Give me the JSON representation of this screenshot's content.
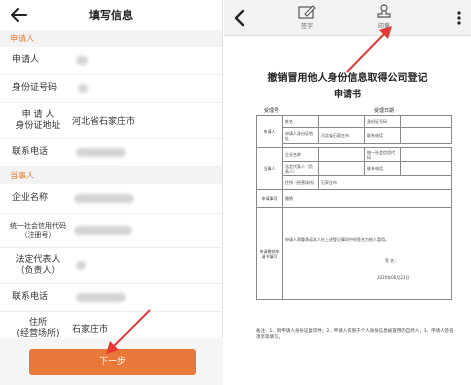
{
  "left": {
    "title": "填写信息",
    "section_applicant": "申请人",
    "section_party": "当事人",
    "fields": {
      "applicant": "申请人",
      "id_number": "身份证号码",
      "id_address": "申 请 人\n身份证地址",
      "id_address_value": "河北省石家庄市",
      "phone": "联系电话",
      "company": "企业名称",
      "credit_code": "统一社会信用代码\n（注册号）",
      "legal_rep": "法定代表人\n（负责人）",
      "phone2": "联系电话",
      "residence": "住所\n(经营场所)",
      "residence_value": "石家庄市"
    },
    "next_button": "下一步"
  },
  "right": {
    "sign_label": "签字",
    "stamp_label": "印章",
    "doc_title": "撤销冒用他人身份信息取得公司登记",
    "doc_subtitle": "申请书",
    "accept_no": "受理号",
    "accept_date": "受理日期",
    "table": {
      "applicant": "申请人",
      "name": "姓名",
      "id_card": "身份证号码",
      "id_address": "申请人身份证地址",
      "id_address_value": "河北省石家庄市",
      "phone": "联系电话",
      "company_name": "企业名称",
      "credit_code": "统一社会信用代码",
      "party": "当事人",
      "legal_rep": "法定代表人（负责人）",
      "legal_rep_extra": "（负责人）",
      "residence": "住所（经营场所）",
      "residence_value": "石家庄市",
      "phone2": "联系电话",
      "matter": "申请事项",
      "matter_value": "撤销",
      "statement": "申请撤销申请书填写",
      "statement_text": "申请人郑重承诺本人在上述登记事项中的签名为他人冒用。",
      "sign": "签 名：",
      "date": "2020年06月23日"
    },
    "note": "备注：1、附申请人身份证复印件；2、申请人仅限于个人身份信息被冒用的自然人；3、申请人签名须亲笔填写。"
  }
}
